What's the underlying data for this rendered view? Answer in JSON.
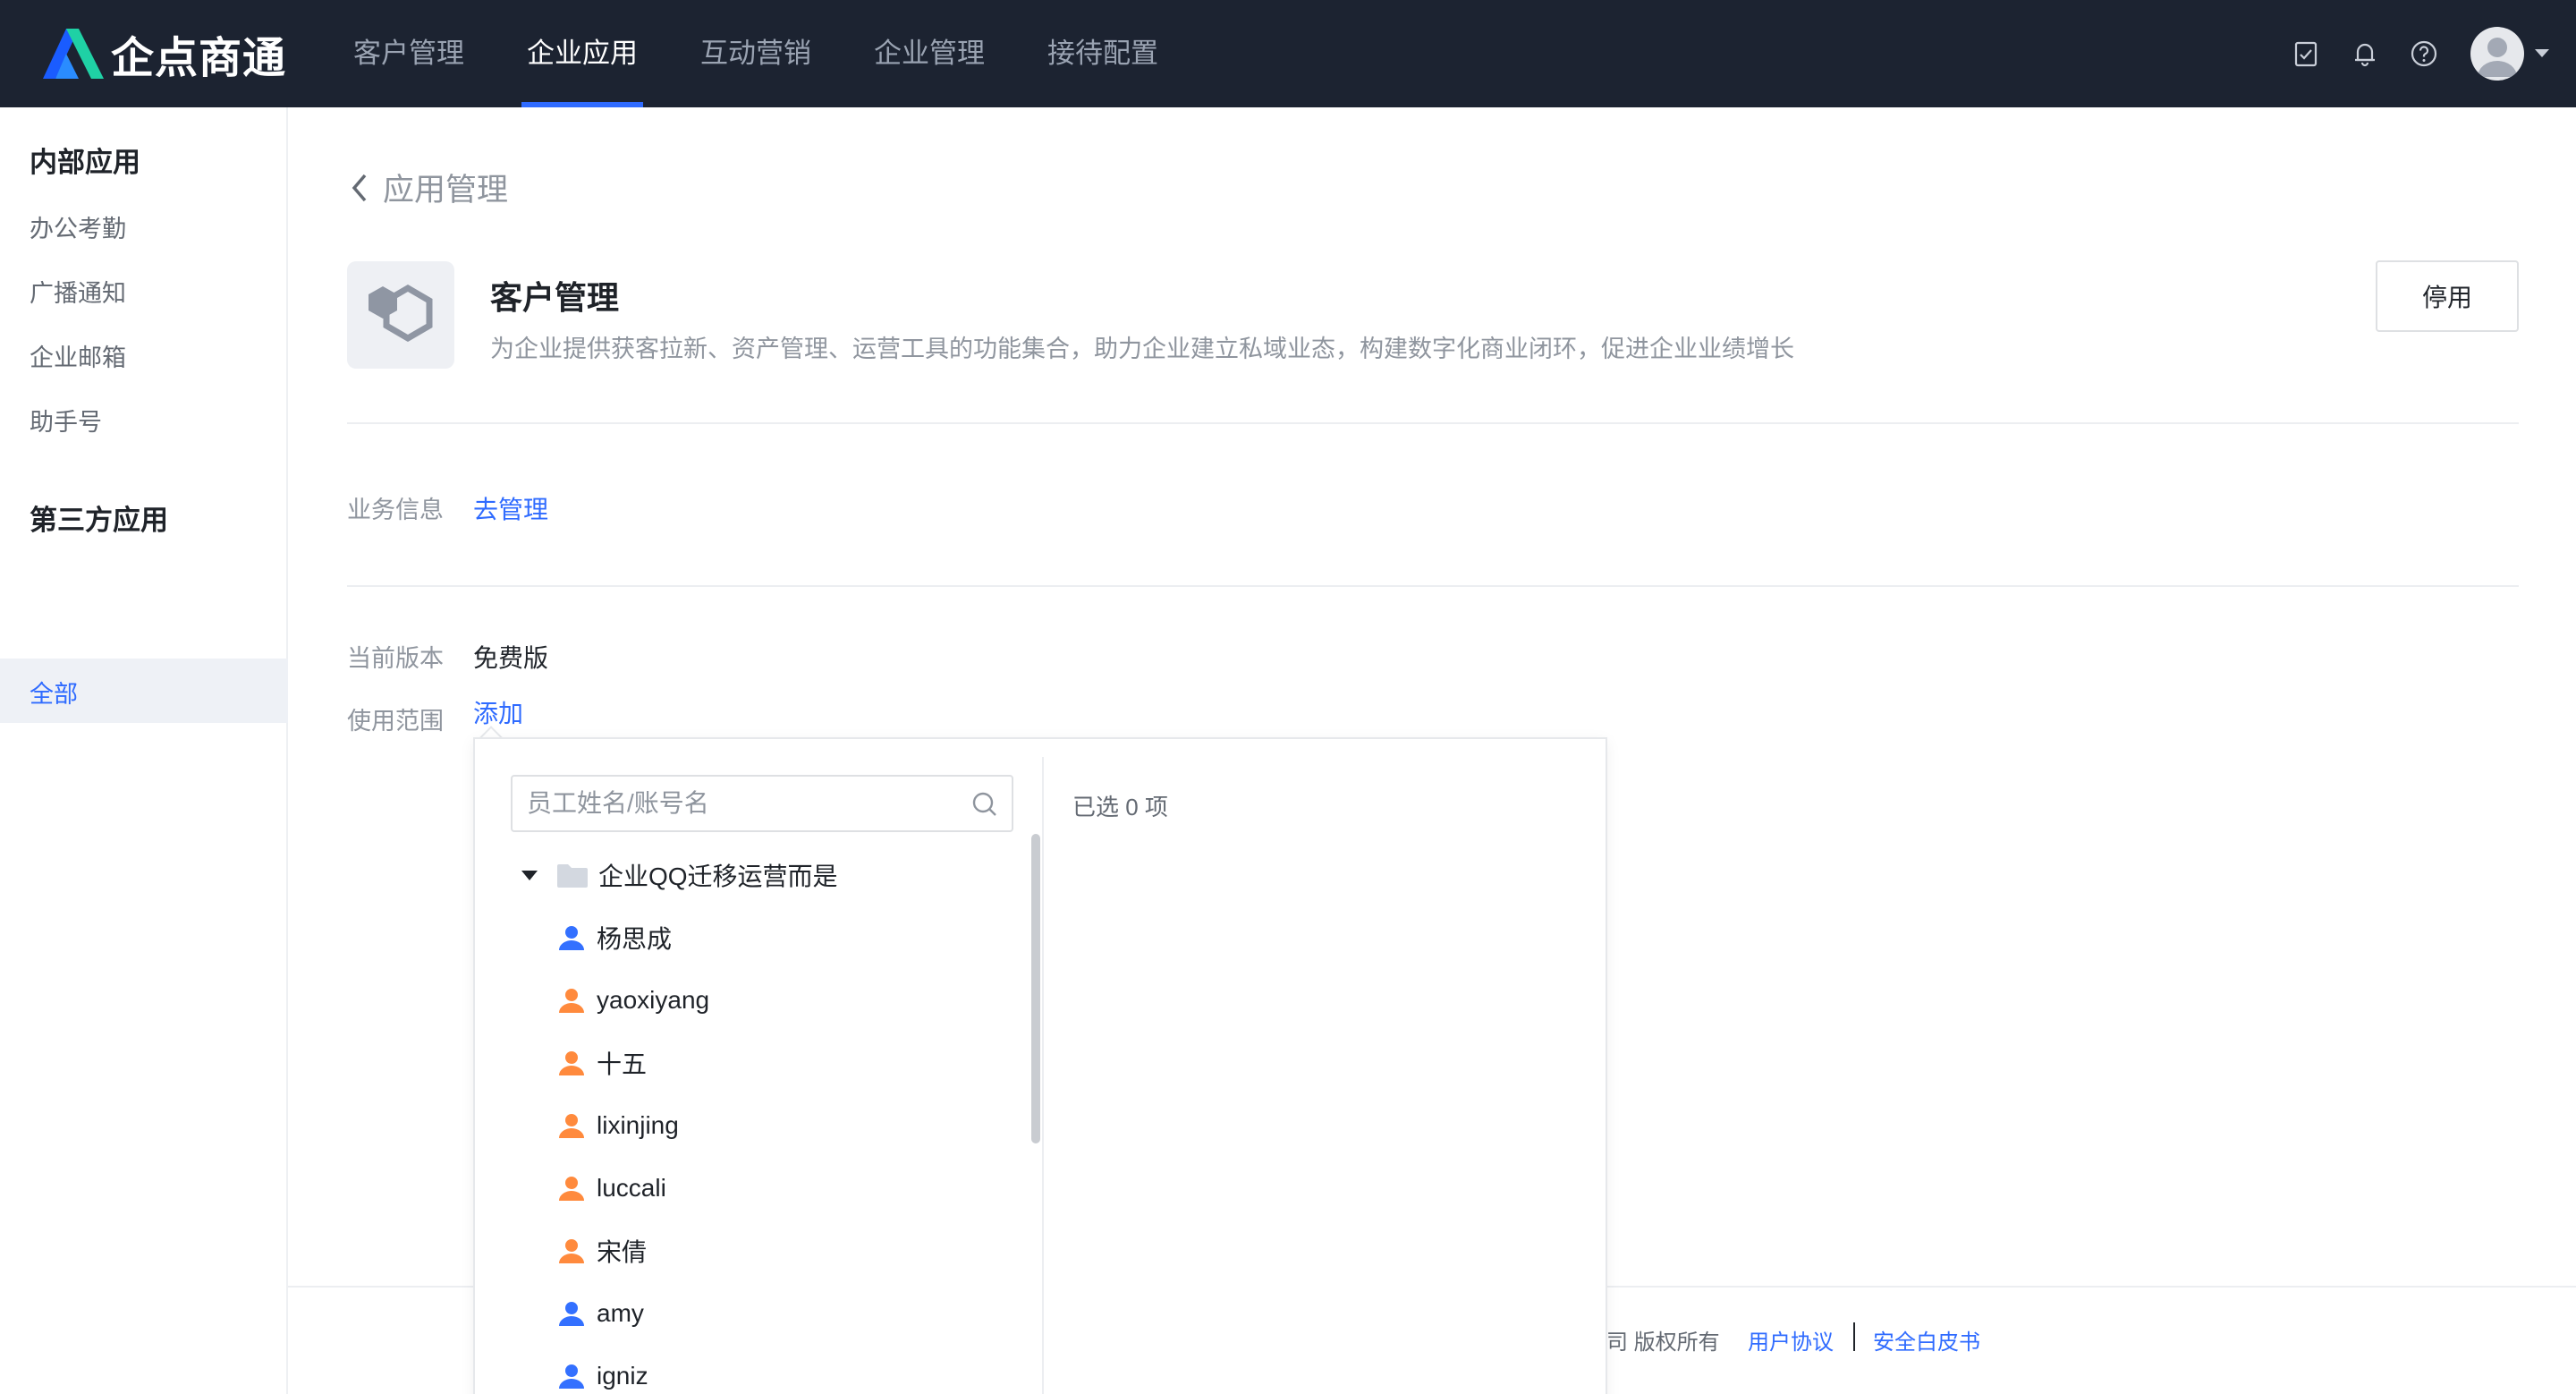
{
  "brand": {
    "name": "企点商通"
  },
  "nav": {
    "items": [
      "客户管理",
      "企业应用",
      "互动营销",
      "企业管理",
      "接待配置"
    ],
    "active_index": 1
  },
  "header_icons": [
    "checklist-icon",
    "bell-icon",
    "help-icon",
    "avatar"
  ],
  "sidebar": {
    "group1": "内部应用",
    "internal": [
      "办公考勤",
      "广播通知",
      "企业邮箱",
      "助手号"
    ],
    "group2": "第三方应用",
    "third_party_active": "全部"
  },
  "main": {
    "back_label": "应用管理",
    "app_title": "客户管理",
    "app_desc": "为企业提供获客拉新、资产管理、运营工具的功能集合，助力企业建立私域业态，构建数字化商业闭环，促进企业业绩增长",
    "stop_label": "停用",
    "business_label": "业务信息",
    "business_link": "去管理",
    "version_label": "当前版本",
    "version_value": "免费版",
    "scope_label": "使用范围",
    "scope_link": "添加"
  },
  "popover": {
    "search_placeholder": "员工姓名/账号名",
    "selected_text": "已选 0 项",
    "tree_root": "企业QQ迁移运营而是",
    "members": [
      {
        "name": "杨思成",
        "color": "#3370ff"
      },
      {
        "name": "yaoxiyang",
        "color": "#ff8a3d"
      },
      {
        "name": "十五",
        "color": "#ff8a3d"
      },
      {
        "name": "lixinjing",
        "color": "#ff8a3d"
      },
      {
        "name": "luccali",
        "color": "#ff8a3d"
      },
      {
        "name": "宋倩",
        "color": "#ff8a3d"
      },
      {
        "name": "amy",
        "color": "#3370ff"
      },
      {
        "name": "igniz",
        "color": "#3370ff"
      }
    ]
  },
  "footer": {
    "copyright_tail": "司 版权所有",
    "link1": "用户协议",
    "link2": "安全白皮书"
  }
}
